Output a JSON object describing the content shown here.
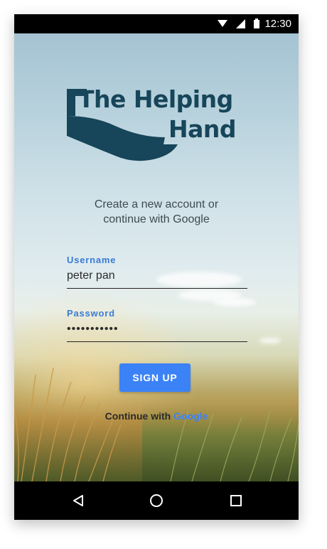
{
  "status_bar": {
    "time": "12:30",
    "icons": [
      "wifi-icon",
      "signal-icon",
      "battery-icon"
    ]
  },
  "logo": {
    "line1": "The Helping",
    "line2": "Hand",
    "color": "#17455a"
  },
  "subtitle": {
    "line1": "Create a new account or",
    "line2": "continue with Google"
  },
  "form": {
    "username": {
      "label": "Username",
      "value": "peter pan"
    },
    "password": {
      "label": "Password",
      "value": "•••••••••••"
    }
  },
  "signup_button": {
    "label": "SIGN UP",
    "color": "#3b82f6"
  },
  "google": {
    "prefix": "Continue with ",
    "link": "Google"
  },
  "nav_bar": {
    "buttons": [
      "back-icon",
      "home-icon",
      "recents-icon"
    ]
  }
}
